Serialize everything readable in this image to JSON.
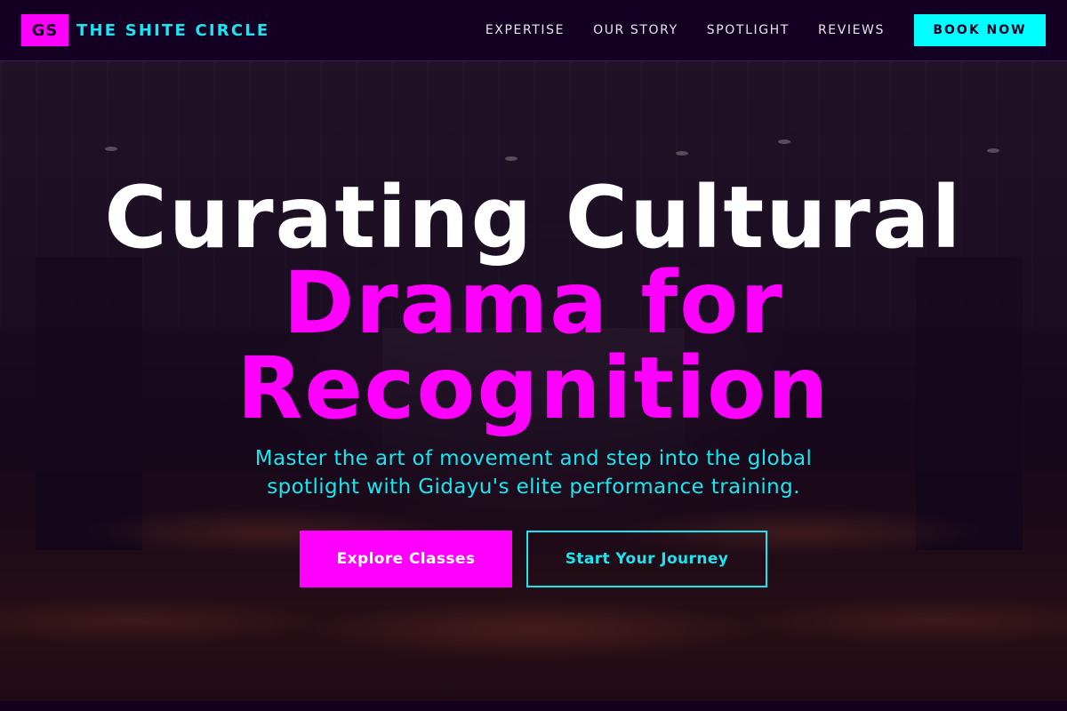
{
  "header": {
    "logo_badge": "GS",
    "brand_name": "THE SHITE CIRCLE",
    "nav": [
      "EXPERTISE",
      "OUR STORY",
      "SPOTLIGHT",
      "REVIEWS"
    ],
    "cta_label": "BOOK NOW"
  },
  "hero": {
    "title_line1": "Curating Cultural",
    "title_line2": "Drama for",
    "title_line3": "Recognition",
    "subtitle": "Master the art of movement and step into the global spotlight with Gidayu's elite performance training.",
    "primary_button": "Explore Classes",
    "secondary_button": "Start Your Journey"
  },
  "colors": {
    "background": "#14001f",
    "magenta": "#ff00ff",
    "cyan": "#00ffff",
    "text_cyan": "#19e6f0",
    "white": "#ffffff"
  }
}
